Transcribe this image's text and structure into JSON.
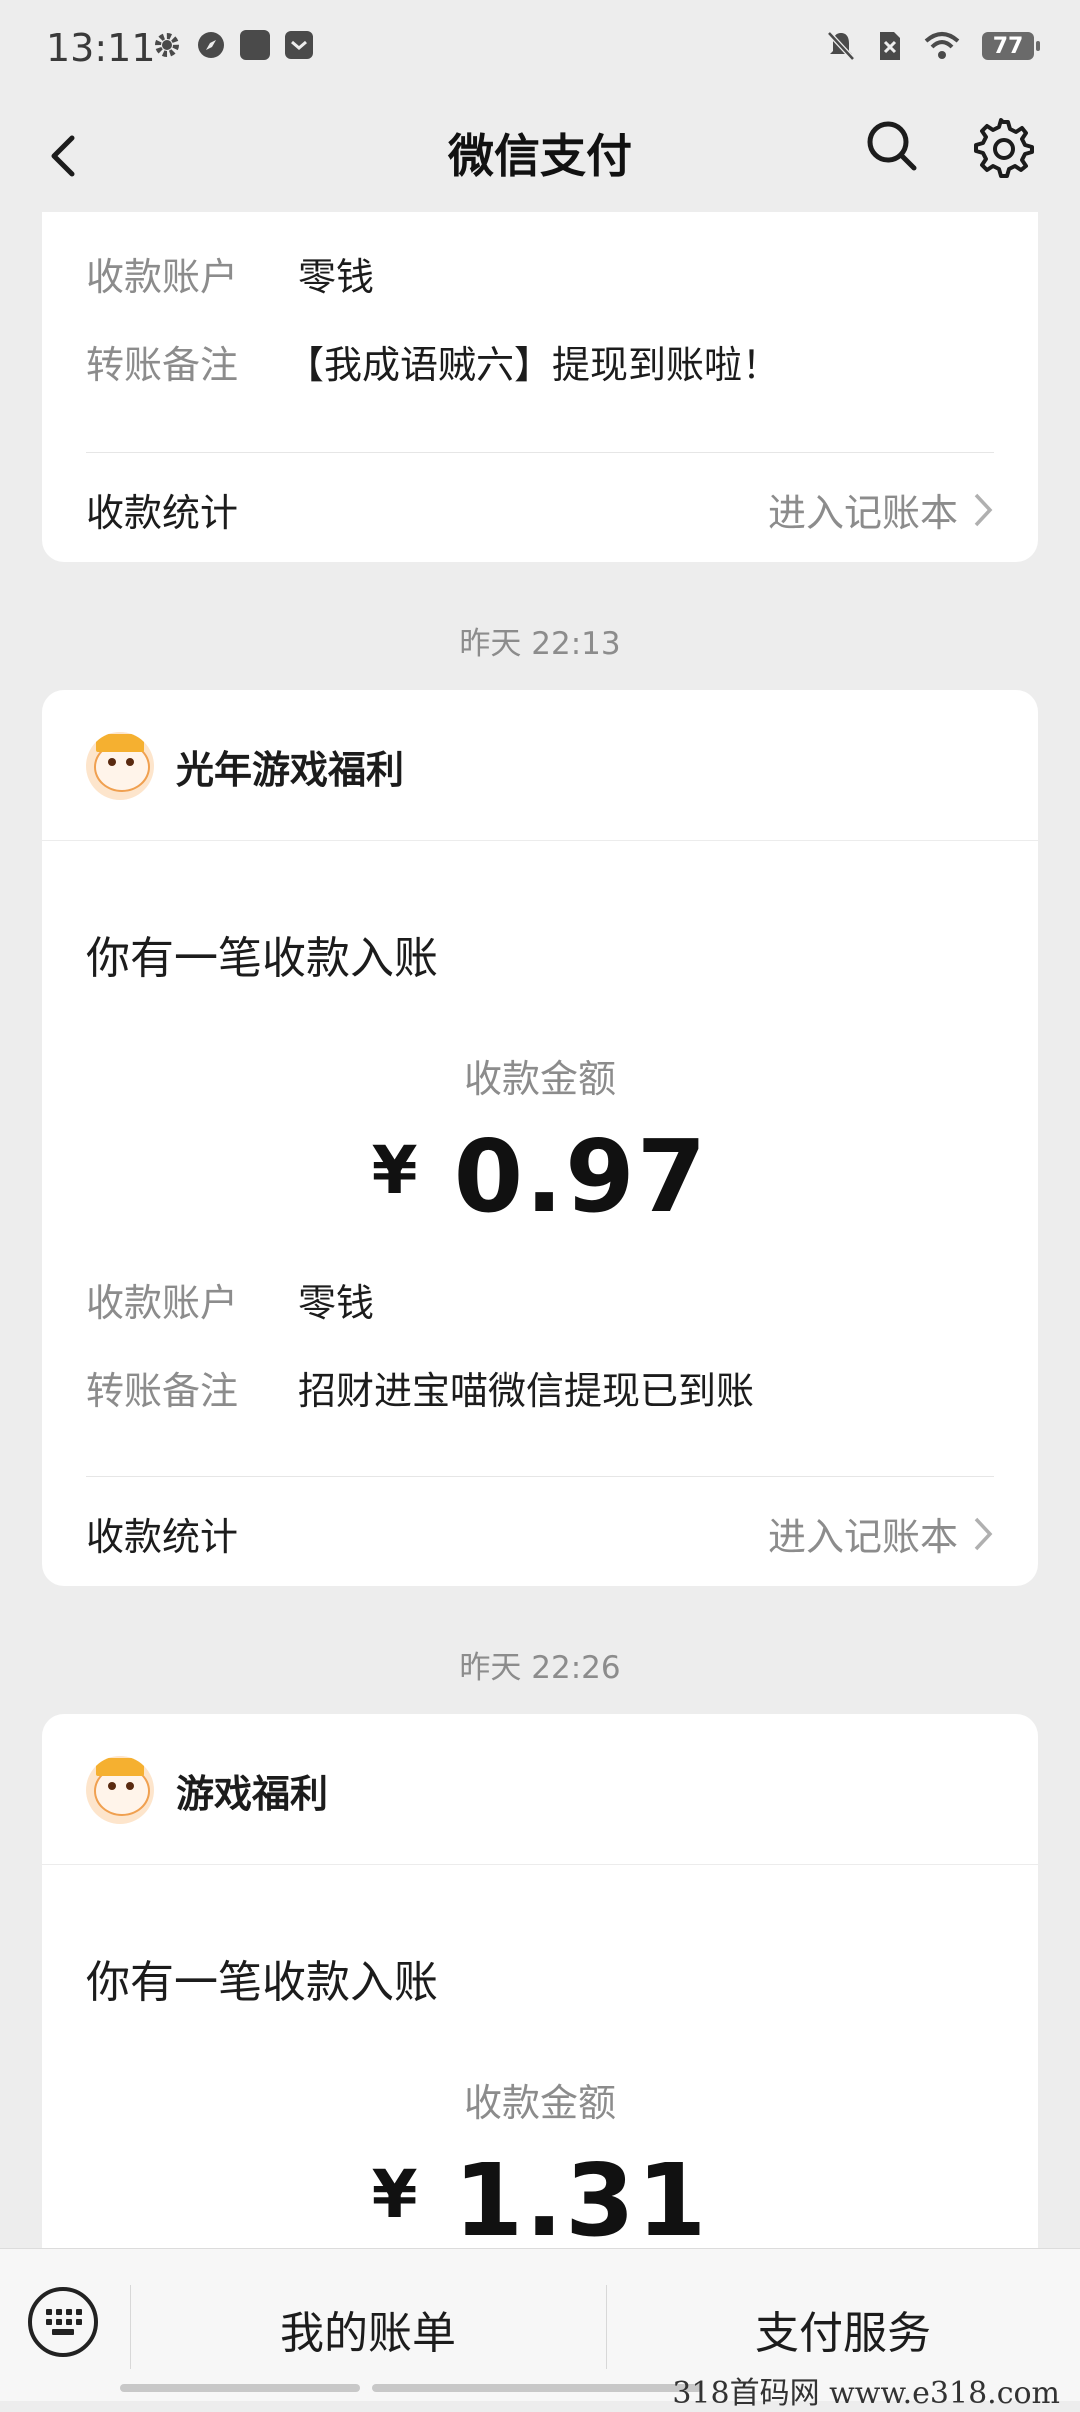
{
  "status_bar": {
    "time": "13:11",
    "battery": "77"
  },
  "nav": {
    "title": "微信支付"
  },
  "card_top": {
    "account_label": "收款账户",
    "account_value": "零钱",
    "remark_label": "转账备注",
    "remark_value": "【我成语贼六】提现到账啦！",
    "stats_label": "收款统计",
    "stats_link": "进入记账本"
  },
  "time1": "昨天 22:13",
  "card1": {
    "sender": "光年游戏福利",
    "headline": "你有一笔收款入账",
    "amount_label": "收款金额",
    "currency": "¥",
    "amount": "0.97",
    "account_label": "收款账户",
    "account_value": "零钱",
    "remark_label": "转账备注",
    "remark_value": "招财进宝喵微信提现已到账",
    "stats_label": "收款统计",
    "stats_link": "进入记账本"
  },
  "time2": "昨天 22:26",
  "card2": {
    "sender": "游戏福利",
    "headline": "你有一笔收款入账",
    "amount_label": "收款金额",
    "currency": "¥",
    "amount": "1.31"
  },
  "bottom": {
    "bills": "我的账单",
    "services": "支付服务"
  },
  "watermark": "318首码网  www.e318.com"
}
